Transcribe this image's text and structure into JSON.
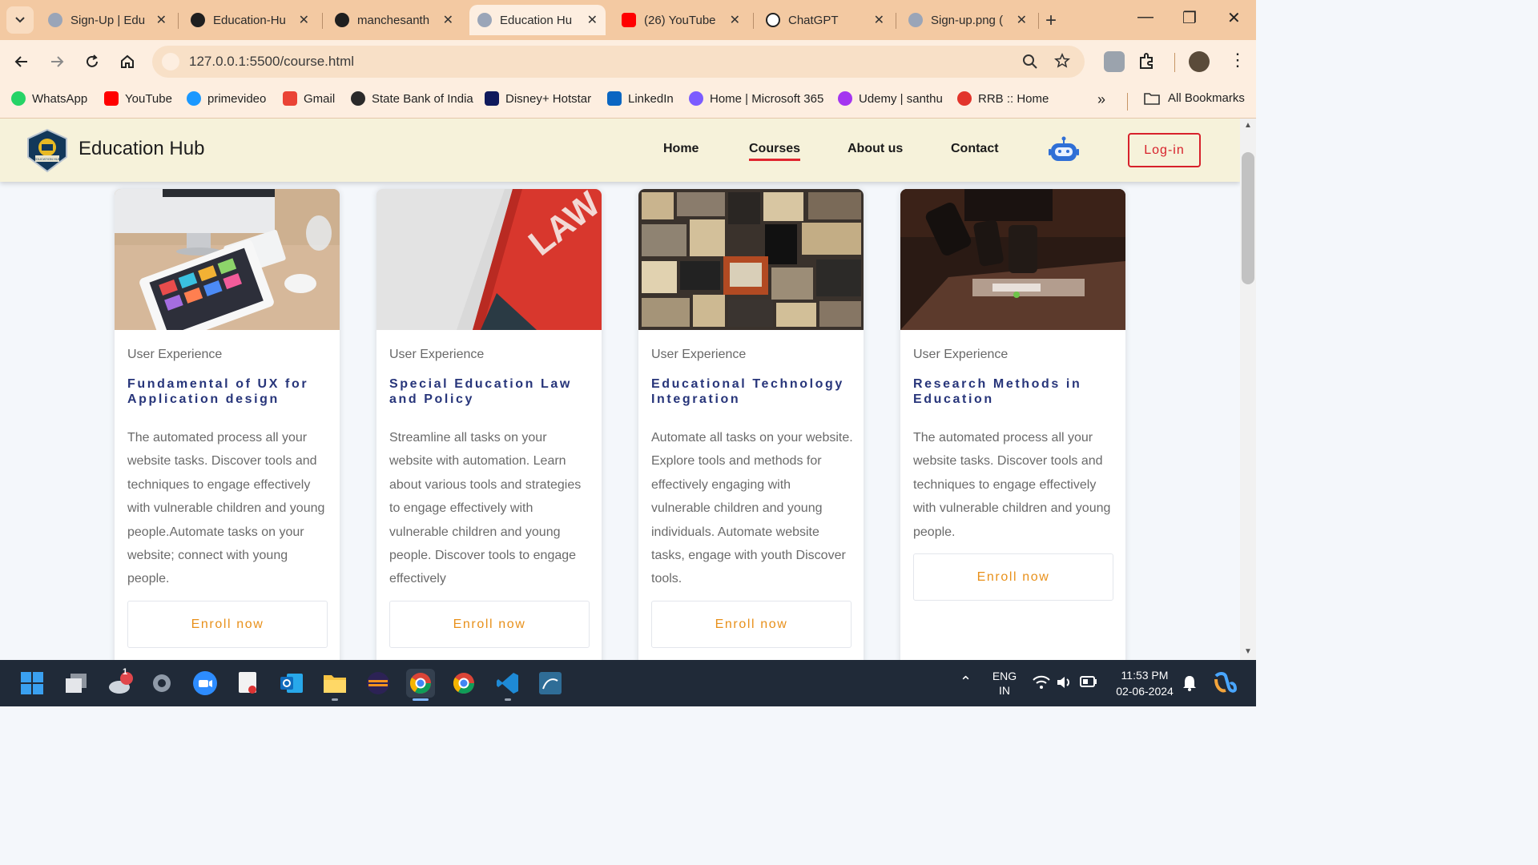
{
  "browser": {
    "tabs": [
      {
        "title": "Sign-Up | Edu",
        "favicon": "globe-icon"
      },
      {
        "title": "Education-Hu",
        "favicon": "github-icon"
      },
      {
        "title": "manchesanth",
        "favicon": "github-icon"
      },
      {
        "title": "Education Hu",
        "favicon": "globe-icon",
        "active": true
      },
      {
        "title": "(26) YouTube",
        "favicon": "youtube-icon"
      },
      {
        "title": "ChatGPT",
        "favicon": "chatgpt-icon"
      },
      {
        "title": "Sign-up.png (",
        "favicon": "globe-icon"
      }
    ],
    "url": "127.0.0.1:5500/course.html",
    "bookmarks": [
      {
        "label": "WhatsApp",
        "color": "#25d366"
      },
      {
        "label": "YouTube",
        "color": "#ff0000"
      },
      {
        "label": "primevideo",
        "color": "#1a98ff"
      },
      {
        "label": "Gmail",
        "color": "#ea4335"
      },
      {
        "label": "State Bank of India",
        "color": "#2a2a2a"
      },
      {
        "label": "Disney+ Hotstar",
        "color": "#0f1a5c"
      },
      {
        "label": "LinkedIn",
        "color": "#0a66c2"
      },
      {
        "label": "Home | Microsoft 365",
        "color": "#7b5cff"
      },
      {
        "label": "Udemy | santhu",
        "color": "#a435f0"
      },
      {
        "label": "RRB :: Home",
        "color": "#e2342b"
      }
    ],
    "all_bookmarks": "All Bookmarks"
  },
  "site": {
    "brand": "Education Hub",
    "logo_text": "EDUCATION HUB",
    "nav": [
      "Home",
      "Courses",
      "About us",
      "Contact"
    ],
    "active_nav": "Courses",
    "login": "Log-in",
    "accent": "#d7212b"
  },
  "courses": [
    {
      "category": "User Experience",
      "title": "Fundamental of UX for Application design",
      "description": "The automated process all your website tasks. Discover tools and techniques to engage effectively with vulnerable children and young people.Automate tasks on your website; connect with young people.",
      "button": "Enroll now"
    },
    {
      "category": "User Experience",
      "title": "Special Education Law and Policy",
      "description": "Streamline all tasks on your website with automation. Learn about various tools and strategies to engage effectively with vulnerable children and young people. Discover tools to engage effectively",
      "button": "Enroll now"
    },
    {
      "category": "User Experience",
      "title": "Educational Technology Integration",
      "description": "Automate all tasks on your website. Explore tools and methods for effectively engaging with vulnerable children and young individuals. Automate website tasks, engage with youth Discover tools.",
      "button": "Enroll now"
    },
    {
      "category": "User Experience",
      "title": "Research Methods in Education",
      "description": "The automated process all your website tasks. Discover tools and techniques to engage effectively with vulnerable children and young people.",
      "button": "Enroll now"
    }
  ],
  "course_images": [
    "laptop-tablet-desk-image",
    "law-book-image",
    "vintage-tv-wall-image",
    "microscope-image"
  ],
  "enroll_color": "#e8901a",
  "title_color": "#27357a",
  "taskbar": {
    "notification_badge": "1",
    "language": "ENG",
    "region": "IN",
    "time": "11:53 PM",
    "date": "02-06-2024"
  }
}
